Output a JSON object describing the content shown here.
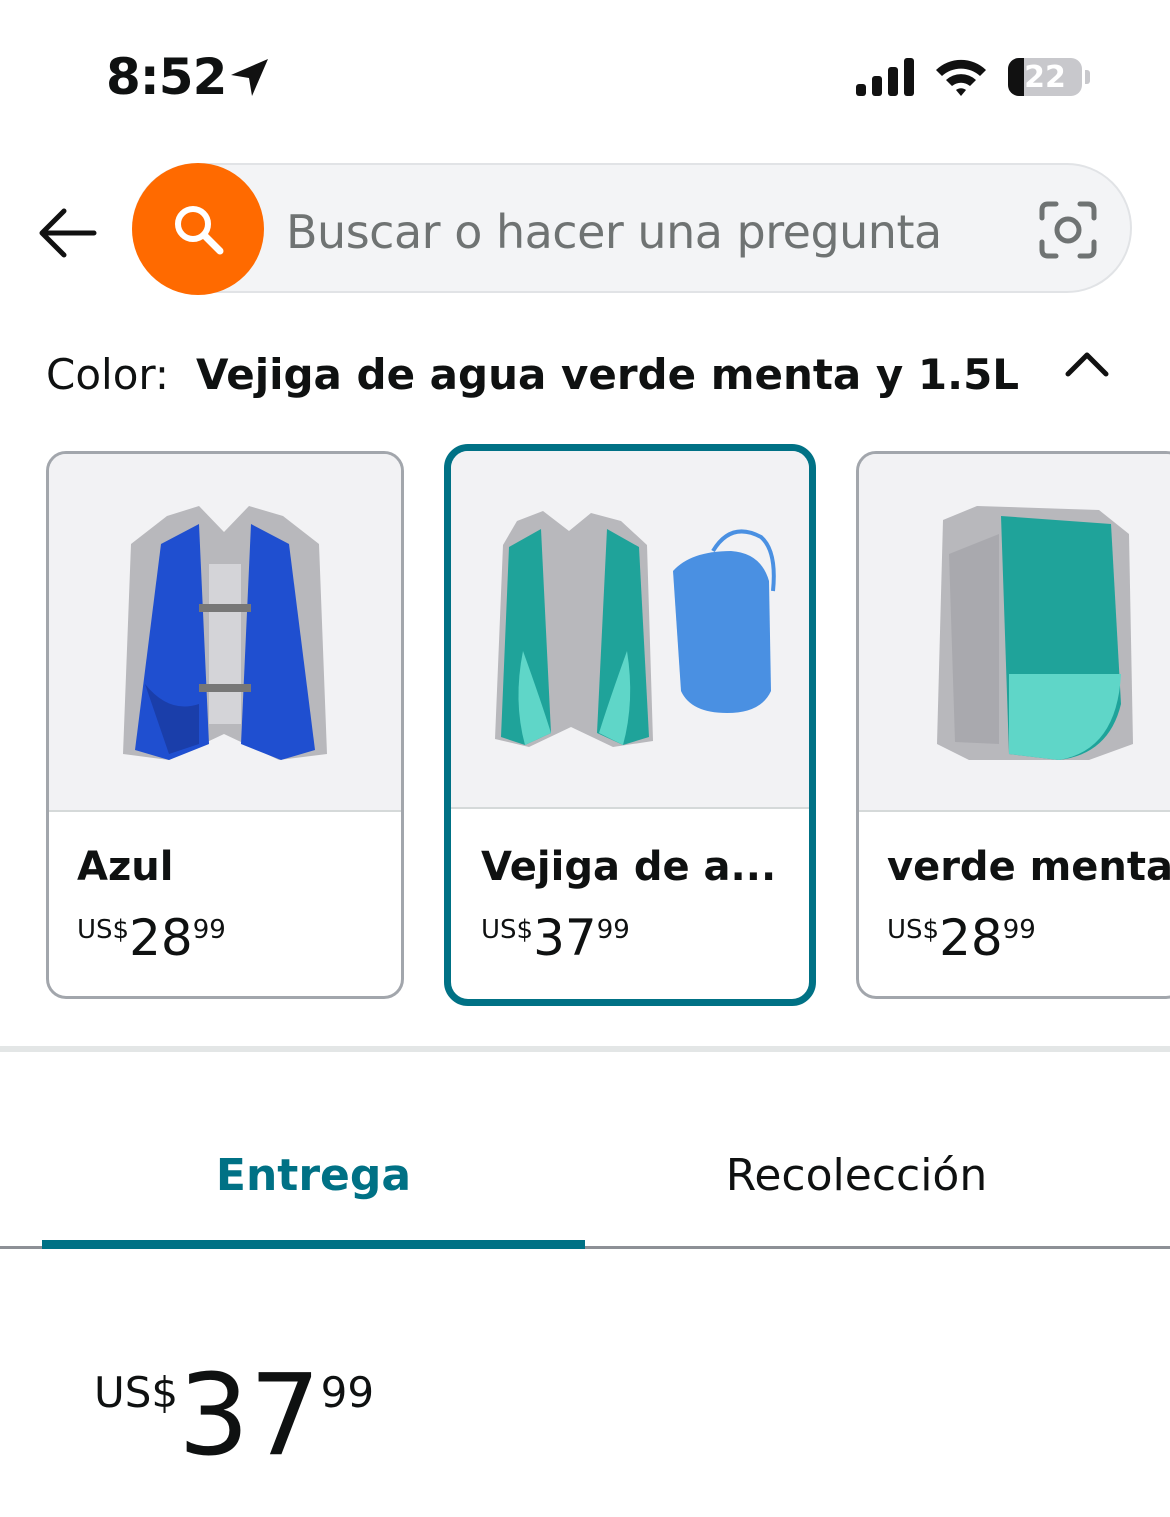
{
  "status_bar": {
    "time": "8:52",
    "battery": "22"
  },
  "search": {
    "placeholder": "Buscar o hacer una pregunta"
  },
  "color_selector": {
    "label": "Color:",
    "selected": "Vejiga de agua verde menta y 1.5L",
    "options": [
      {
        "name": "Azul",
        "price": {
          "currency": "US$",
          "whole": "28",
          "fraction": "99"
        },
        "selected": false
      },
      {
        "name": "Vejiga de a...",
        "price": {
          "currency": "US$",
          "whole": "37",
          "fraction": "99"
        },
        "selected": true
      },
      {
        "name": "verde menta",
        "price": {
          "currency": "US$",
          "whole": "28",
          "fraction": "99"
        },
        "selected": false
      }
    ]
  },
  "tabs": [
    {
      "label": "Entrega",
      "active": true
    },
    {
      "label": "Recolección",
      "active": false
    }
  ],
  "price": {
    "currency": "US$",
    "whole": "37",
    "fraction": "99"
  },
  "colors": {
    "accent": "#007185",
    "search_button": "#ff6a00"
  }
}
